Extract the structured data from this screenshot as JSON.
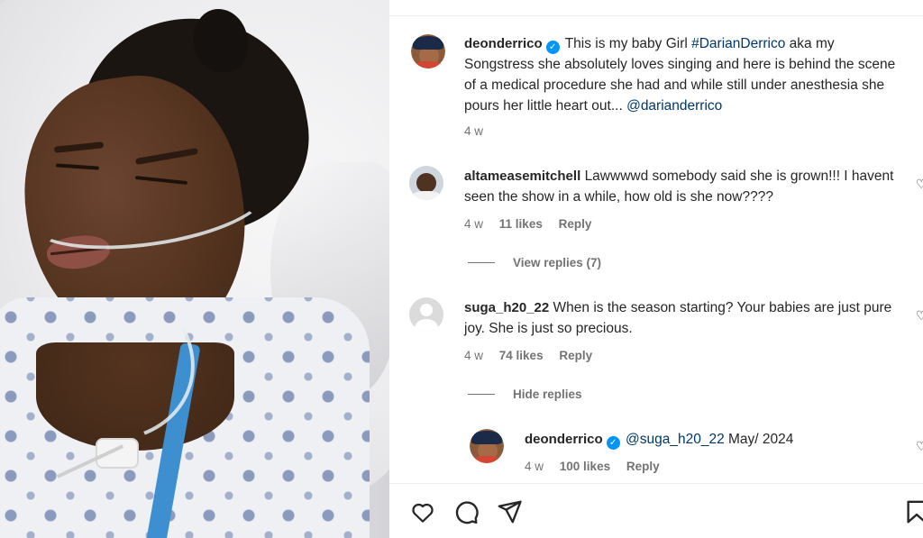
{
  "post": {
    "author": "deonderrico",
    "caption": "This is my baby Girl ",
    "caption_tag": "#DarianDerrico",
    "caption_rest": " aka my Songstress she absolutely loves singing and here is behind the scene of a medical procedure she had and while still under anesthesia she pours her little heart out... ",
    "caption_mention": "@darianderrico",
    "age": "4 w"
  },
  "comments": [
    {
      "user": "altameasemitchell",
      "text": "Lawwwwd somebody said she is grown!!! I havent seen the show in a while, how old is she now????",
      "age": "4 w",
      "likes": "11 likes",
      "reply": "Reply",
      "thread_toggle": "View replies (7)"
    },
    {
      "user": "suga_h20_22",
      "text": "When is the season starting? Your babies are just pure joy. She is just so precious.",
      "age": "4 w",
      "likes": "74 likes",
      "reply": "Reply",
      "thread_toggle": "Hide replies"
    }
  ],
  "reply": {
    "user": "deonderrico",
    "mention": "@suga_h20_22",
    "text": " May/ 2024",
    "age": "4 w",
    "likes": "100 likes",
    "reply": "Reply"
  },
  "icons": {
    "verified": "verified-badge-icon",
    "like": "heart-icon",
    "comment": "comment-icon",
    "share": "send-icon",
    "save": "bookmark-icon"
  },
  "colors": {
    "link": "#00376b",
    "verified": "#0095f6",
    "meta": "#737373"
  }
}
